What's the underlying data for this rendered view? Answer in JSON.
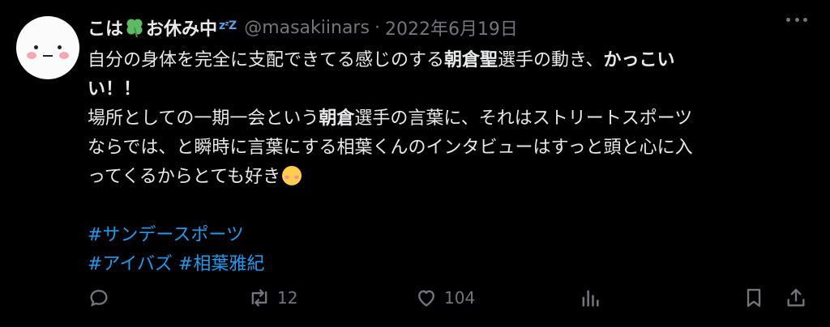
{
  "tweet": {
    "display_name": "こは",
    "display_name_2": "お休み中",
    "status_glyph": "zᶻZ",
    "handle": "@masakiinars",
    "separator": "·",
    "date": "2022年6月19日",
    "body": {
      "l1_a": "自分の身体を完全に支配できてる感じのする",
      "l1_b": "朝倉聖",
      "l1_c": "選手の動き、",
      "l1_d": "かっこい",
      "l2": "い！！",
      "l3_a": "場所としての一期一会という",
      "l3_b": "朝倉",
      "l3_c": "選手の言葉に、それはストリートスポーツ",
      "l4": "ならでは、と瞬時に言葉にする相葉くんのインタビューはすっと頭と心に入",
      "l5": "ってくるからとても好き"
    },
    "hashtags": [
      "#サンデースポーツ",
      "#アイバズ",
      "#相葉雅紀"
    ],
    "actions": {
      "retweets": "12",
      "likes": "104"
    }
  },
  "colors": {
    "background": "#000000",
    "text": "#e7e9ea",
    "muted": "#71767b",
    "link": "#1d9bf0"
  },
  "icons": [
    "reply-icon",
    "retweet-icon",
    "like-icon",
    "views-icon",
    "bookmark-icon",
    "share-icon",
    "more-icon",
    "clover-emoji",
    "smiling-face-emoji"
  ]
}
